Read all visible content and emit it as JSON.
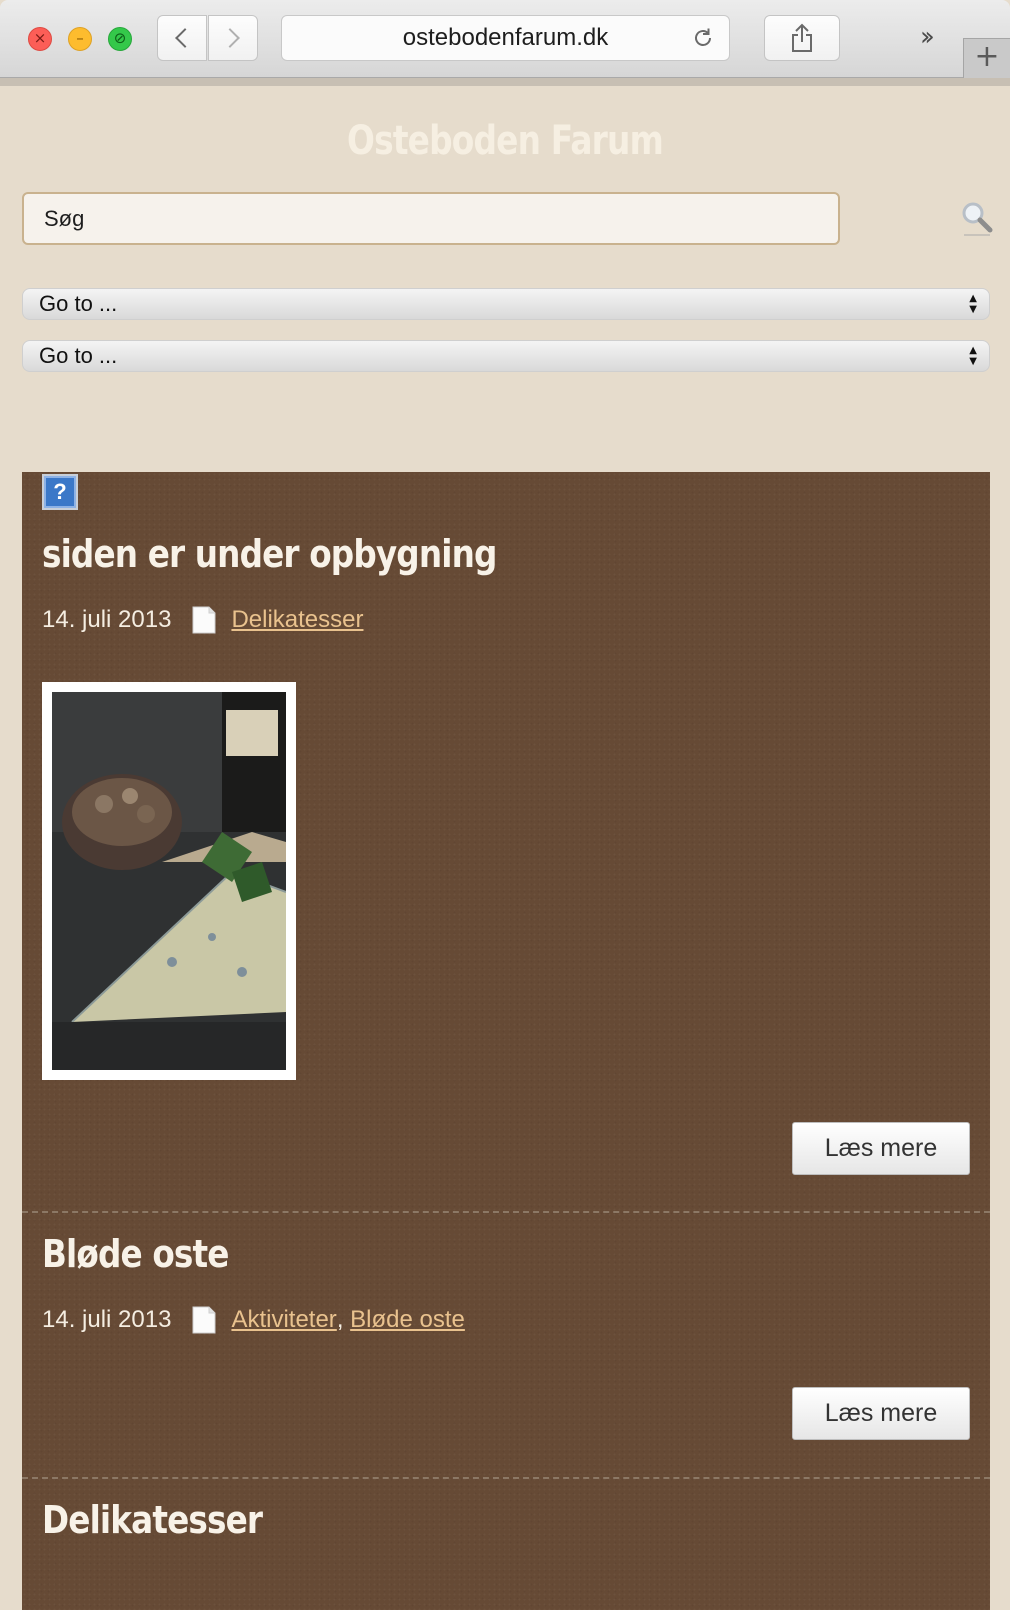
{
  "browser": {
    "url": "ostebodenfarum.dk"
  },
  "site": {
    "title": "Osteboden Farum"
  },
  "search": {
    "value": "Søg"
  },
  "nav": {
    "select1": "Go to ...",
    "select2": "Go to ..."
  },
  "posts": [
    {
      "title": "siden er under opbygning",
      "date": "14. juli 2013",
      "categories": [
        "Delikatesser"
      ],
      "read_more": "Læs mere"
    },
    {
      "title": "Bløde oste",
      "date": "14. juli 2013",
      "categories": [
        "Aktiviteter",
        "Bløde oste"
      ],
      "read_more": "Læs mere"
    },
    {
      "title": "Delikatesser"
    }
  ],
  "colors": {
    "page_bg": "#e6dccc",
    "content_bg": "#664a35",
    "link": "#e9c28e",
    "title_text": "#f8f2e8"
  },
  "icons": {
    "close": "close-icon",
    "minimize": "minimize-icon",
    "fullscreen": "fullscreen-icon",
    "back": "back-arrow-icon",
    "forward": "forward-arrow-icon",
    "reload": "reload-icon",
    "share": "share-icon",
    "more_tabs": "chevron-double-right-icon",
    "new_tab": "plus-icon",
    "search": "magnifier-icon",
    "broken_image": "broken-image-icon",
    "category": "document-icon"
  }
}
